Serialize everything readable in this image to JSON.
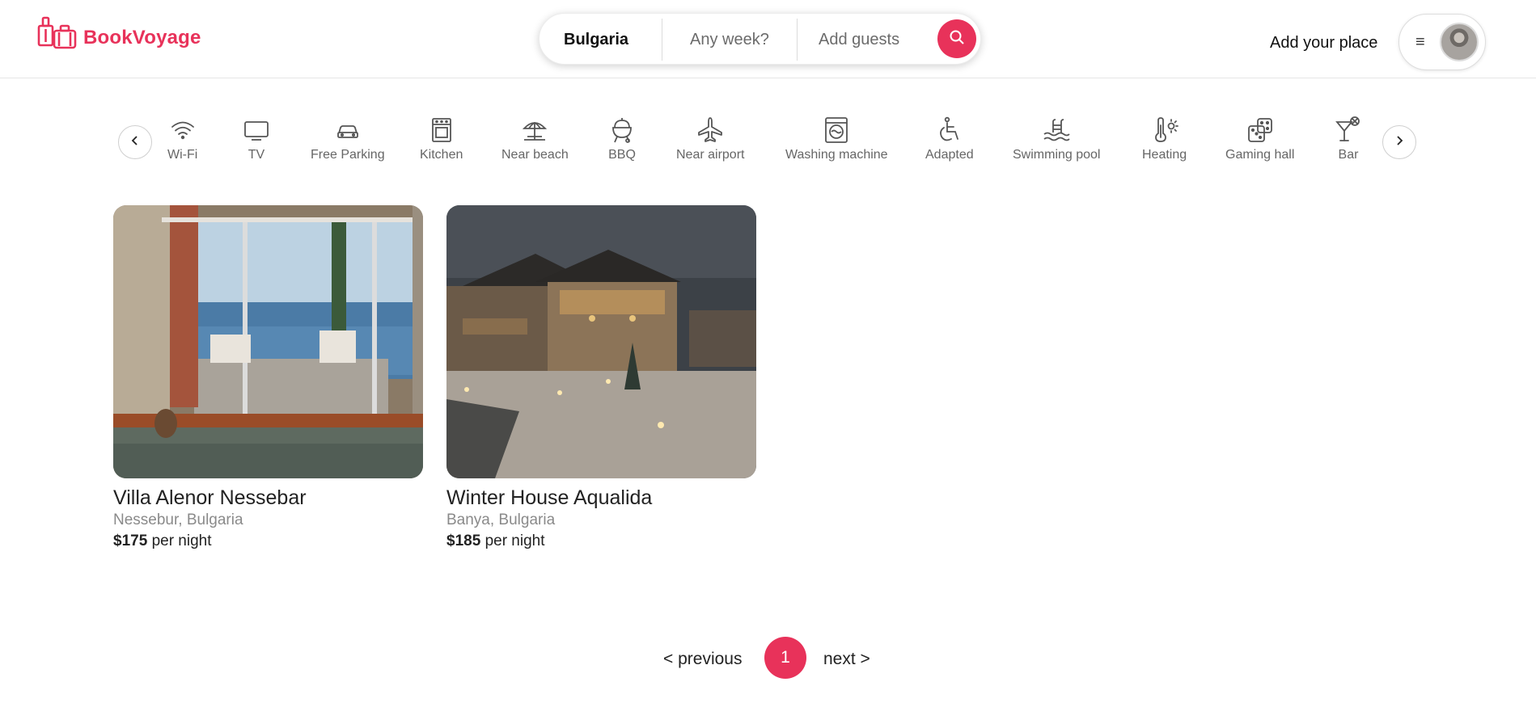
{
  "brand": {
    "name": "BookVoyage",
    "color": "#e8325a",
    "logo_icon": "suitcase-icon"
  },
  "search": {
    "location": "Bulgaria",
    "week_placeholder": "Any week?",
    "guests_placeholder": "Add guests",
    "button_icon": "search-icon"
  },
  "header": {
    "add_place": "Add your place",
    "menu_icon": "hamburger-icon"
  },
  "amenities": [
    {
      "label": "Wi-Fi",
      "icon": "wifi-icon"
    },
    {
      "label": "TV",
      "icon": "tv-icon"
    },
    {
      "label": "Free Parking",
      "icon": "car-icon"
    },
    {
      "label": "Kitchen",
      "icon": "oven-icon"
    },
    {
      "label": "Near beach",
      "icon": "beach-umbrella-icon"
    },
    {
      "label": "BBQ",
      "icon": "grill-icon"
    },
    {
      "label": "Near airport",
      "icon": "airplane-icon"
    },
    {
      "label": "Washing machine",
      "icon": "washing-machine-icon"
    },
    {
      "label": "Adapted",
      "icon": "wheelchair-icon"
    },
    {
      "label": "Swimming pool",
      "icon": "pool-icon"
    },
    {
      "label": "Heating",
      "icon": "thermometer-icon"
    },
    {
      "label": "Gaming hall",
      "icon": "dice-icon"
    },
    {
      "label": "Bar",
      "icon": "cocktail-icon"
    }
  ],
  "listings": [
    {
      "title": "Villa Alenor Nessebar",
      "location": "Nessebur, Bulgaria",
      "price": "$175",
      "price_suffix": "per night"
    },
    {
      "title": "Winter House Aqualida",
      "location": "Banya, Bulgaria",
      "price": "$185",
      "price_suffix": "per night"
    }
  ],
  "pagination": {
    "previous": "< previous",
    "current": "1",
    "next": "next >"
  }
}
